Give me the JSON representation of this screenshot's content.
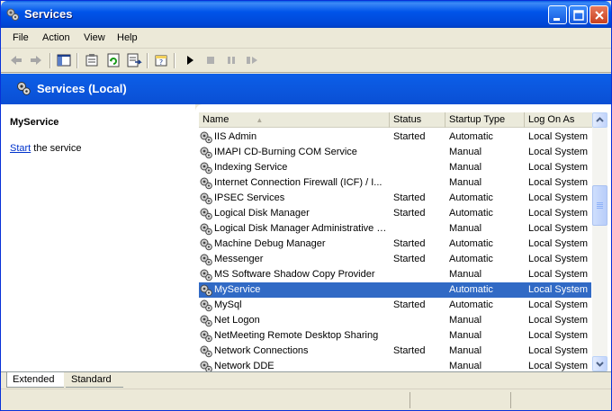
{
  "window": {
    "title": "Services"
  },
  "menu": [
    "File",
    "Action",
    "View",
    "Help"
  ],
  "toolbar": {
    "icons": [
      "back-icon",
      "forward-icon",
      "show-hide-console-tree-icon",
      "properties-icon",
      "refresh-icon",
      "export-list-icon",
      "help-icon",
      "start-service-icon",
      "stop-service-icon",
      "pause-service-icon",
      "restart-service-icon"
    ]
  },
  "header": {
    "title": "Services (Local)"
  },
  "left_panel": {
    "service_name": "MyService",
    "start_link": "Start",
    "start_suffix": " the service"
  },
  "list": {
    "columns": [
      "Name",
      "Status",
      "Startup Type",
      "Log On As"
    ],
    "rows": [
      {
        "name": "IIS Admin",
        "status": "Started",
        "startup": "Automatic",
        "logon": "Local System"
      },
      {
        "name": "IMAPI CD-Burning COM Service",
        "status": "",
        "startup": "Manual",
        "logon": "Local System"
      },
      {
        "name": "Indexing Service",
        "status": "",
        "startup": "Manual",
        "logon": "Local System"
      },
      {
        "name": "Internet Connection Firewall (ICF) / I...",
        "status": "",
        "startup": "Manual",
        "logon": "Local System"
      },
      {
        "name": "IPSEC Services",
        "status": "Started",
        "startup": "Automatic",
        "logon": "Local System"
      },
      {
        "name": "Logical Disk Manager",
        "status": "Started",
        "startup": "Automatic",
        "logon": "Local System"
      },
      {
        "name": "Logical Disk Manager Administrative S...",
        "status": "",
        "startup": "Manual",
        "logon": "Local System"
      },
      {
        "name": "Machine Debug Manager",
        "status": "Started",
        "startup": "Automatic",
        "logon": "Local System"
      },
      {
        "name": "Messenger",
        "status": "Started",
        "startup": "Automatic",
        "logon": "Local System"
      },
      {
        "name": "MS Software Shadow Copy Provider",
        "status": "",
        "startup": "Manual",
        "logon": "Local System"
      },
      {
        "name": "MyService",
        "status": "",
        "startup": "Automatic",
        "logon": "Local System",
        "selected": true
      },
      {
        "name": "MySql",
        "status": "Started",
        "startup": "Automatic",
        "logon": "Local System"
      },
      {
        "name": "Net Logon",
        "status": "",
        "startup": "Manual",
        "logon": "Local System"
      },
      {
        "name": "NetMeeting Remote Desktop Sharing",
        "status": "",
        "startup": "Manual",
        "logon": "Local System"
      },
      {
        "name": "Network Connections",
        "status": "Started",
        "startup": "Manual",
        "logon": "Local System"
      },
      {
        "name": "Network DDE",
        "status": "",
        "startup": "Manual",
        "logon": "Local System"
      }
    ]
  },
  "tabs": [
    "Extended",
    "Standard"
  ],
  "colors": {
    "title_bar": "#0055ea",
    "selection": "#316ac5",
    "header_band": "#0a52d8",
    "link": "#0033cc"
  }
}
